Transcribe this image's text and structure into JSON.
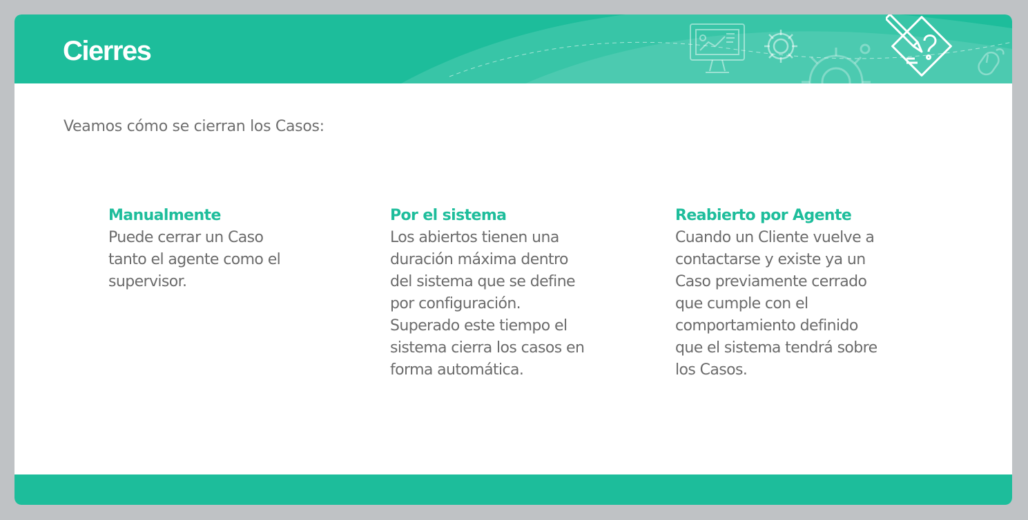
{
  "header": {
    "title": "Cierres",
    "background_color": "#1dbd9b",
    "icons": [
      "presentation-screen-icon",
      "gear-icon",
      "large-gear-icon",
      "pencil-question-icon",
      "mouse-icon"
    ]
  },
  "main": {
    "intro": "Veamos cómo se cierran los Casos:",
    "columns": [
      {
        "title": "Manualmente",
        "lines": [
          "Puede cerrar un Caso",
          "tanto el agente como el",
          "supervisor."
        ]
      },
      {
        "title": "Por el sistema",
        "lines": [
          "Los abiertos tienen una",
          "duración máxima dentro",
          "del sistema que se define",
          "por configuración.",
          "Superado este tiempo el",
          "sistema cierra los casos en",
          "forma automática."
        ]
      },
      {
        "title": "Reabierto por Agente",
        "lines": [
          "Cuando un Cliente vuelve a",
          "contactarse y existe ya un",
          "Caso previamente cerrado",
          "que cumple con el",
          "comportamiento definido",
          "que el sistema tendrá sobre",
          "los Casos."
        ]
      }
    ]
  },
  "colors": {
    "accent": "#1dbd9b",
    "text": "#6b6b6b",
    "frame": "#bfc2c5"
  }
}
